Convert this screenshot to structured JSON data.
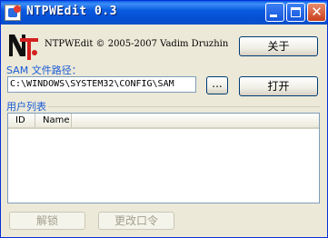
{
  "window": {
    "title": "NTPWEdit 0.3"
  },
  "header": {
    "copyright": "NTPWEdit © 2005-2007 Vadim Druzhin",
    "about_label": "关于"
  },
  "sam": {
    "label": "SAM 文件路径：",
    "path_value": "C:\\WINDOWS\\SYSTEM32\\CONFIG\\SAM",
    "browse_label": "...",
    "open_label": "打开"
  },
  "users": {
    "group_label": "用户列表",
    "columns": [
      "ID",
      "Name"
    ],
    "rows": []
  },
  "actions": {
    "unlock_label": "解锁",
    "change_password_label": "更改口令"
  },
  "colors": {
    "titlebar": "#0a5ae0",
    "label_blue": "#1a5cd7",
    "face": "#ece9d8"
  }
}
